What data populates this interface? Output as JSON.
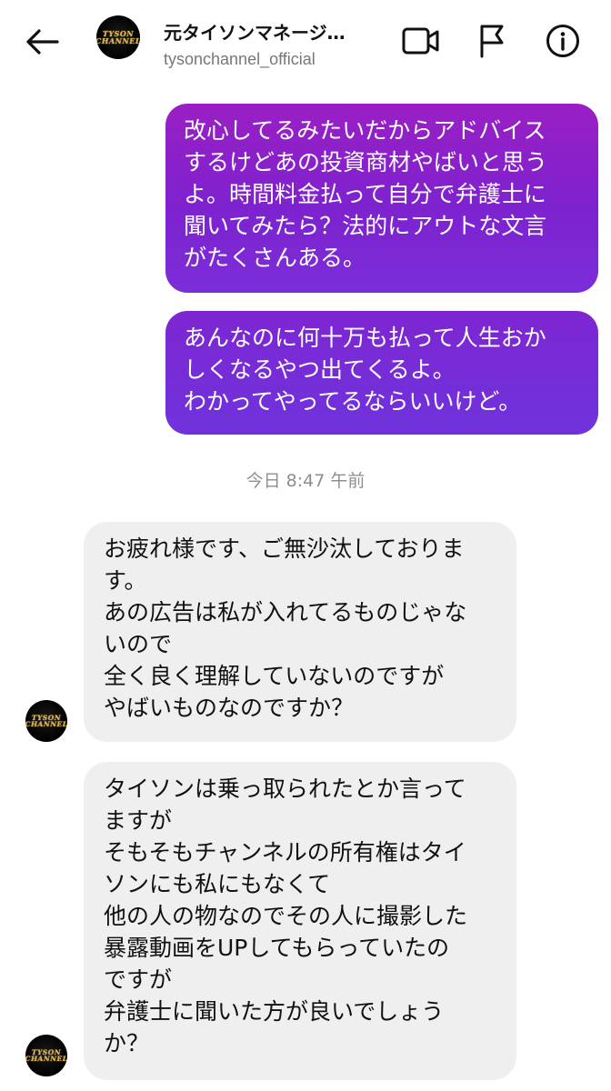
{
  "header": {
    "title": "元タイソンマネージ…",
    "username": "tysonchannel_official",
    "avatar_logo_line1": "TYSON",
    "avatar_logo_line2": "CHANNEL"
  },
  "icons": {
    "back": "arrow-left-icon",
    "video": "video-camera-icon",
    "report": "flag-icon",
    "info": "info-icon"
  },
  "messages": {
    "outgoing_1": "改心してるみたいだからアドバイス\nするけどあの投資商材やばいと思う\nよ。時間料金払って自分で弁護士に\n聞いてみたら？法的にアウトな文言\nがたくさんある。",
    "outgoing_2": "あんなのに何十万も払って人生おか\nしくなるやつ出てくるよ。\nわかってやってるならいいけど。",
    "timestamp": "今日 8:47 午前",
    "incoming_1": "お疲れ様です、ご無沙汰しておりま\nす。\nあの広告は私が入れてるものじゃな\nいので\n全く良く理解していないのですが\nやばいものなのですか？",
    "incoming_2": "タイソンは乗っ取られたとか言って\nますが\nそもそもチャンネルの所有権はタイ\nソンにも私にもなくて\n他の人の物なのでその人に撮影した\n暴露動画をUPしてもらっていたの\nですが\n弁護士に聞いた方が良いでしょう\nか？"
  },
  "colors": {
    "outgoing_gradient_top": "#9a1fc4",
    "outgoing_gradient_bottom": "#6f33dc",
    "incoming_bubble": "#efefef",
    "logo_gold": "#e0b34a"
  }
}
